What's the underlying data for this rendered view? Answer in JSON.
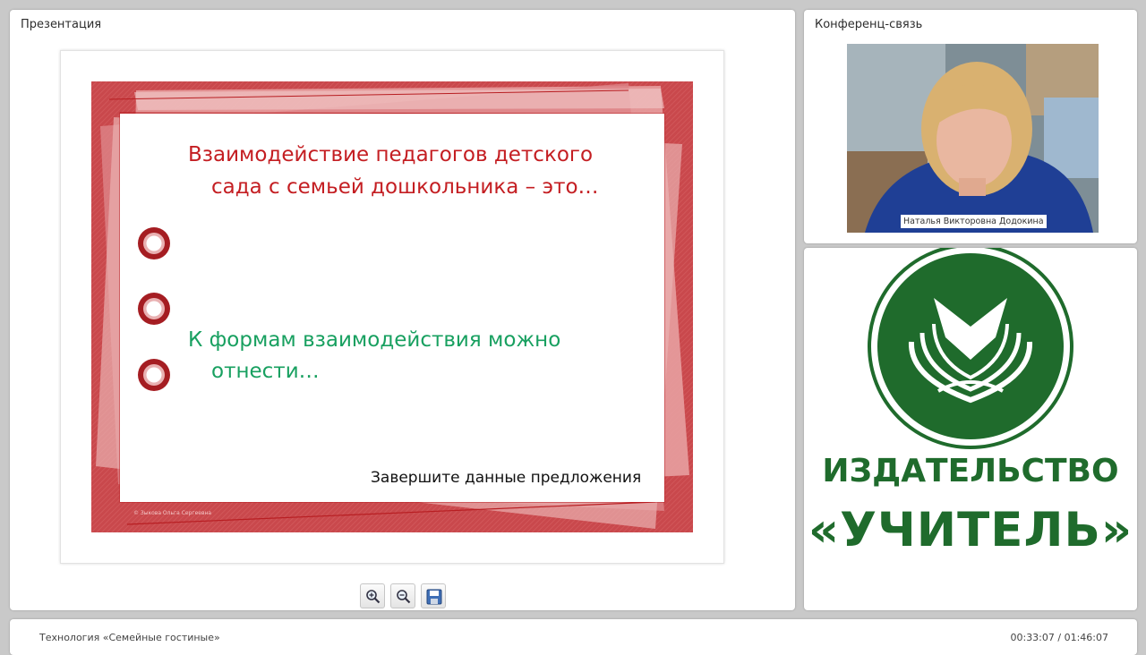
{
  "presentation_panel": {
    "title": "Презентация",
    "slide": {
      "heading_line1": "Взаимодействие педагогов детского",
      "heading_line2": "сада с семьей дошкольника – это…",
      "prompt_line1": "К формам взаимодействия можно",
      "prompt_line2": "отнести…",
      "footer": "Завершите данные предложения",
      "copyright": "© Зыкова Ольга Сергеевна"
    },
    "toolbar": {
      "zoom_in_icon": "zoom-in-icon",
      "zoom_out_icon": "zoom-out-icon",
      "save_icon": "floppy-disk-icon"
    }
  },
  "conference_panel": {
    "title": "Конференц-связь",
    "speaker_name": "Наталья Викторовна Додокина"
  },
  "logo_panel": {
    "line1": "ИЗДАТЕЛЬСТВО",
    "line2": "«УЧИТЕЛЬ»"
  },
  "bottom_bar": {
    "course_title": "Технология «Семейные гостиные»",
    "time": "00:33:07 / 01:46:07"
  },
  "colors": {
    "slide_red": "#c41e22",
    "slide_green": "#18a060",
    "logo_green": "#1f6b2c"
  }
}
